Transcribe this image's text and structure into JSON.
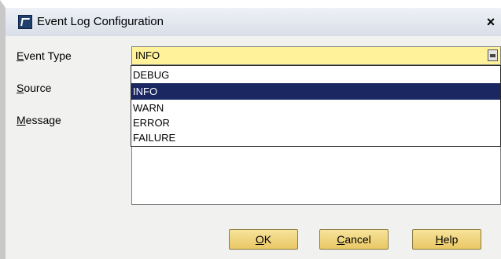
{
  "window": {
    "title": "Event Log Configuration",
    "close_label": "×"
  },
  "labels": {
    "event_type": {
      "mnemonic": "E",
      "rest": "vent Type"
    },
    "source": {
      "mnemonic": "S",
      "rest": "ource"
    },
    "message": {
      "mnemonic": "M",
      "rest": "essage"
    }
  },
  "event_type_combo": {
    "selected_value": "INFO",
    "options": [
      "DEBUG",
      "INFO",
      "WARN",
      "ERROR",
      "FAILURE"
    ]
  },
  "buttons": {
    "ok": {
      "mnemonic": "O",
      "rest": "K"
    },
    "cancel": {
      "mnemonic": "C",
      "rest": "ancel"
    },
    "help": {
      "mnemonic": "H",
      "rest": "elp"
    }
  },
  "colors": {
    "combo_background": "#fff29a",
    "selected_option": "#1b2761",
    "button_fill": "#e9c765",
    "dialog_background": "#f1f1ef"
  }
}
